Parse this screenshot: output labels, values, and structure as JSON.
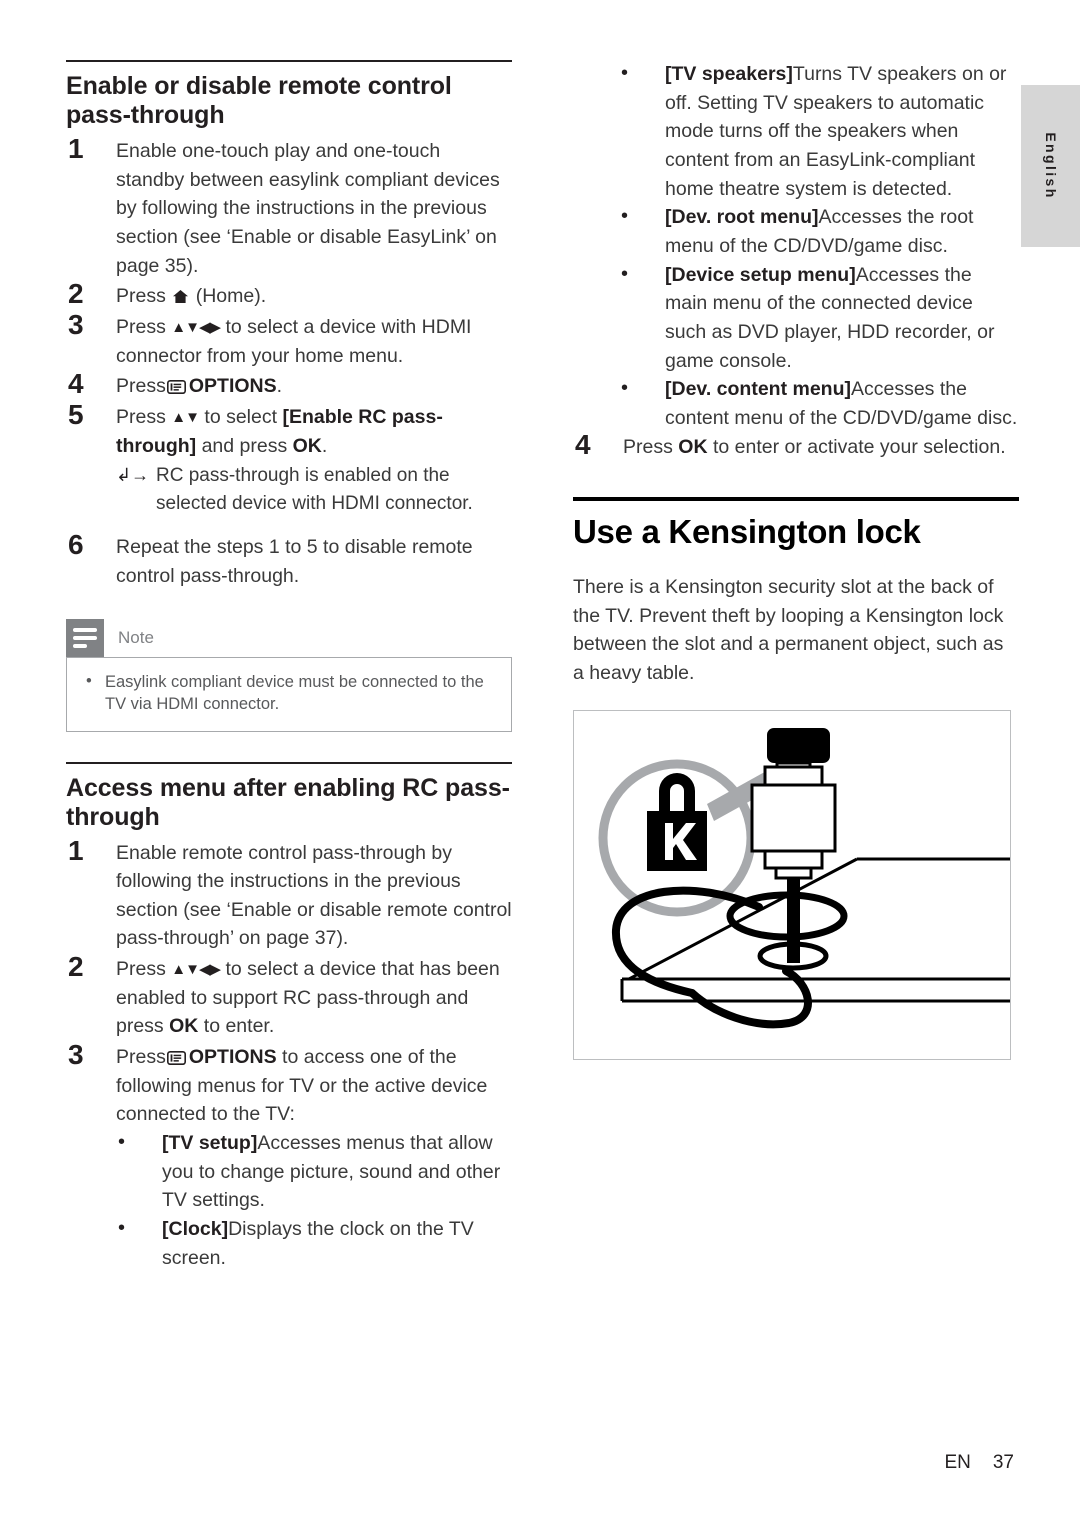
{
  "page": {
    "language_tab": "English",
    "footer_locale": "EN",
    "footer_page_number": "37"
  },
  "left_column": {
    "section1": {
      "heading": "Enable or disable remote control pass-through",
      "steps": [
        {
          "number": "1",
          "text": "Enable one-touch play and one-touch standby between easylink compliant devices by following the instructions in the previous section (see ‘Enable or disable EasyLink’ on page 35)."
        },
        {
          "number": "2",
          "text_before": "Press",
          "icon": "home-icon",
          "text_after": "(Home)."
        },
        {
          "number": "3",
          "text_before": "Press",
          "navkeys": "▲▼◀▶",
          "text_after": "to select a device with HDMI connector from your home menu."
        },
        {
          "number": "4",
          "text_before": "Press",
          "icon": "options-icon",
          "bold_label": "OPTIONS",
          "text_after": "."
        },
        {
          "number": "5",
          "text_before": "Press",
          "navkeys": "▲▼",
          "text_mid": "to select",
          "bold_label": "[Enable RC pass-through]",
          "text_mid2": "and press",
          "bold_label2": "OK",
          "text_after": ".",
          "arrow_note": "RC pass-through is enabled on the selected device with HDMI connector."
        },
        {
          "number": "6",
          "text": "Repeat the steps 1 to 5 to disable remote control pass-through."
        }
      ]
    },
    "note": {
      "title": "Note",
      "items": [
        "Easylink compliant device must be connected to the TV via HDMI connector."
      ]
    },
    "section2": {
      "heading": "Access menu after enabling RC pass-through",
      "steps": [
        {
          "number": "1",
          "text": "Enable remote control pass-through by following the instructions in the previous section (see ‘Enable or disable remote control pass-through’ on page 37)."
        },
        {
          "number": "2",
          "text_before": "Press",
          "navkeys": "▲▼◀▶",
          "text_mid": "to select a device that has been enabled to support RC pass-through and press",
          "bold_label": "OK",
          "text_after": "to enter."
        },
        {
          "number": "3",
          "text_before": "Press",
          "icon": "options-icon",
          "bold_label": "OPTIONS",
          "text_after": "to access one of the following menus for TV or the active device connected to the TV:",
          "bullets": [
            {
              "label": "[TV setup]",
              "text": "Accesses menus that allow you to change picture, sound and other TV settings."
            },
            {
              "label": "[Clock]",
              "text": "Displays the clock on the TV screen."
            }
          ]
        }
      ]
    }
  },
  "right_column": {
    "continued_bullets": [
      {
        "label": "[TV speakers]",
        "text": "Turns TV speakers on or off. Setting TV speakers to automatic mode turns off the speakers when content from an EasyLink-compliant home theatre system is detected."
      },
      {
        "label": "[Dev. root menu]",
        "text": "Accesses the root menu of the CD/DVD/game disc."
      },
      {
        "label": "[Device setup menu]",
        "text": "Accesses the main menu of the connected device such as DVD player, HDD recorder, or game console."
      },
      {
        "label": "[Dev. content menu]",
        "text": "Accesses the content menu of the CD/DVD/game disc."
      }
    ],
    "step4": {
      "number": "4",
      "text_before": "Press",
      "bold_label": "OK",
      "text_after": "to enter or activate your selection."
    },
    "section": {
      "heading": "Use a Kensington lock",
      "paragraph": "There is a Kensington security slot at the back of the TV. Prevent theft by looping a Kensington lock between the slot and a permanent object, such as a heavy table."
    },
    "figure": {
      "name": "kensington-lock-illustration",
      "elements": [
        "kensington-logo-circle",
        "lock-cylinder",
        "lock-cable-loop",
        "table-surface",
        "callout-leader-line"
      ]
    }
  },
  "colors": {
    "text": "#231f20",
    "body_text": "#3a3a3a",
    "note_gray": "#808285",
    "tab_gray": "#d6d6d6",
    "frame_gray": "#bcbec0"
  }
}
